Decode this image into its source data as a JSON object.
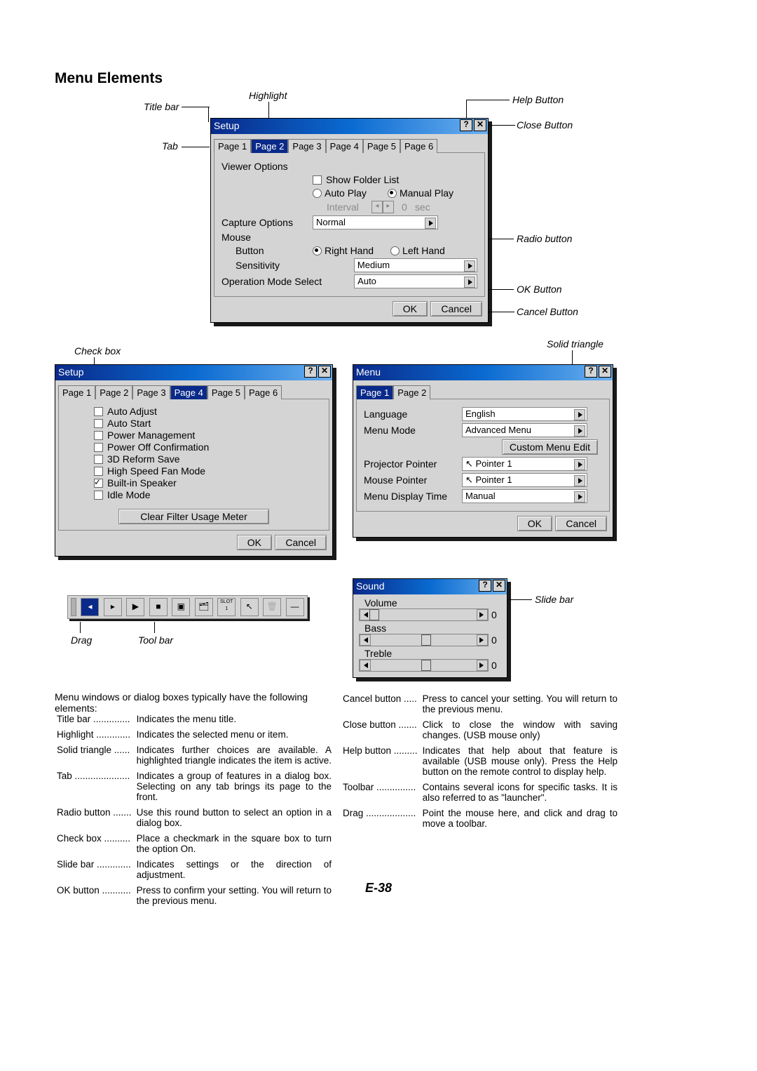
{
  "heading": "Menu Elements",
  "labels": {
    "titlebar": "Title bar",
    "highlight": "Highlight",
    "helpbtn": "Help Button",
    "closebtn": "Close Button",
    "tab": "Tab",
    "radiobtn": "Radio button",
    "okbtn": "OK Button",
    "cancelbtn": "Cancel Button",
    "checkbox": "Check box",
    "solidtri": "Solid triangle",
    "drag": "Drag",
    "toolbar": "Tool bar",
    "slidebar": "Slide bar"
  },
  "setup1": {
    "title": "Setup",
    "tabs": [
      "Page 1",
      "Page 2",
      "Page 3",
      "Page 4",
      "Page 5",
      "Page 6"
    ],
    "active": 1,
    "viewer": "Viewer Options",
    "showfolder": "Show Folder List",
    "autoplay": "Auto Play",
    "manualplay": "Manual Play",
    "interval": "Interval",
    "intval": "0",
    "sec": "sec",
    "capture": "Capture Options",
    "captureval": "Normal",
    "mouse": "Mouse",
    "button": "Button",
    "righthand": "Right Hand",
    "lefthand": "Left Hand",
    "sensitivity": "Sensitivity",
    "sensval": "Medium",
    "opmode": "Operation Mode Select",
    "opval": "Auto",
    "ok": "OK",
    "cancel": "Cancel"
  },
  "setup2": {
    "title": "Setup",
    "tabs": [
      "Page 1",
      "Page 2",
      "Page 3",
      "Page 4",
      "Page 5",
      "Page 6"
    ],
    "active": 3,
    "items": [
      {
        "label": "Auto Adjust",
        "on": false
      },
      {
        "label": "Auto Start",
        "on": false
      },
      {
        "label": "Power Management",
        "on": false
      },
      {
        "label": "Power Off Confirmation",
        "on": false
      },
      {
        "label": "3D Reform Save",
        "on": false
      },
      {
        "label": "High Speed Fan Mode",
        "on": false
      },
      {
        "label": "Built-in Speaker",
        "on": true
      },
      {
        "label": "Idle Mode",
        "on": false
      }
    ],
    "clearbtn": "Clear Filter Usage Meter",
    "ok": "OK",
    "cancel": "Cancel"
  },
  "menu": {
    "title": "Menu",
    "tabs": [
      "Page 1",
      "Page 2"
    ],
    "active": 0,
    "language": "Language",
    "langval": "English",
    "menumode": "Menu Mode",
    "menumodeval": "Advanced Menu",
    "custom": "Custom Menu Edit",
    "projptr": "Projector Pointer",
    "projval": "Pointer 1",
    "mouseptr": "Mouse Pointer",
    "mouseval": "Pointer 1",
    "disptime": "Menu Display Time",
    "dispval": "Manual",
    "ok": "OK",
    "cancel": "Cancel"
  },
  "sound": {
    "title": "Sound",
    "volume": "Volume",
    "volval": "0",
    "bass": "Bass",
    "bassval": "0",
    "treble": "Treble",
    "trebleval": "0"
  },
  "intro": "Menu windows or dialog boxes typically have the following elements:",
  "defsL": [
    [
      "Title bar ..............",
      "Indicates the menu title."
    ],
    [
      "Highlight .............",
      "Indicates the selected menu or item."
    ],
    [
      "Solid triangle ......",
      "Indicates further choices are available. A highlighted triangle indicates the item is active."
    ],
    [
      "Tab .....................",
      "Indicates a group of features in a dialog box. Selecting on any tab brings its page to the front."
    ],
    [
      "Radio button .......",
      "Use this round button to select an option in a dialog box."
    ],
    [
      "Check box ..........",
      "Place a checkmark in the square box to turn the option On."
    ],
    [
      "Slide bar .............",
      "Indicates settings or the direction of adjustment."
    ],
    [
      "OK button ...........",
      "Press to confirm your setting. You will return to the previous menu."
    ]
  ],
  "defsR": [
    [
      "Cancel button .....",
      "Press to cancel your setting. You will return to the previous menu."
    ],
    [
      "Close button .......",
      "Click to close the window with saving changes. (USB mouse only)"
    ],
    [
      "Help button .........",
      "Indicates that help about that feature is available (USB mouse only). Press the Help button on the remote control to display help."
    ],
    [
      "Toolbar ...............",
      "Contains several icons for specific tasks. It is also referred to as \"launcher\"."
    ],
    [
      "Drag ...................",
      "Point the mouse here, and click and drag to move a toolbar."
    ]
  ],
  "pagenum": "E-38"
}
